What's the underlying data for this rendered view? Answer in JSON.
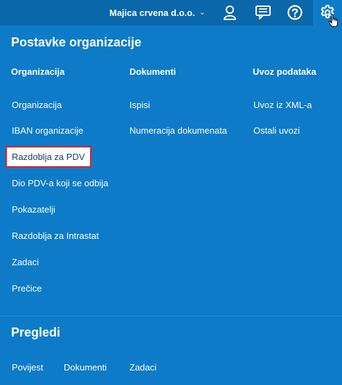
{
  "topbar": {
    "org_name": "Majica crvena d.o.o.",
    "icons": [
      "user-icon",
      "messages-icon",
      "help-icon",
      "settings-icon"
    ]
  },
  "settings_section": {
    "title": "Postavke organizacije",
    "columns": [
      {
        "heading": "Organizacija",
        "items": [
          "Organizacija",
          "IBAN organizacije",
          "Razdoblja za PDV",
          "Dio PDV-a koji se odbija",
          "Pokazatelji",
          "Razdoblja za Intrastat",
          "Zadaci",
          "Prečice"
        ]
      },
      {
        "heading": "Dokumenti",
        "items": [
          "Ispisi",
          "Numeracija dokumenata"
        ]
      },
      {
        "heading": "Uvoz podataka",
        "items": [
          "Uvoz iz XML-a",
          "Ostali uvozi"
        ]
      }
    ]
  },
  "reviews_section": {
    "title": "Pregledi",
    "items": [
      "Povijest",
      "Dokumenti",
      "Zadaci"
    ]
  },
  "colors": {
    "background": "#0d7bc7",
    "topbar": "#0a67aa",
    "highlight_border": "#e2202a"
  }
}
